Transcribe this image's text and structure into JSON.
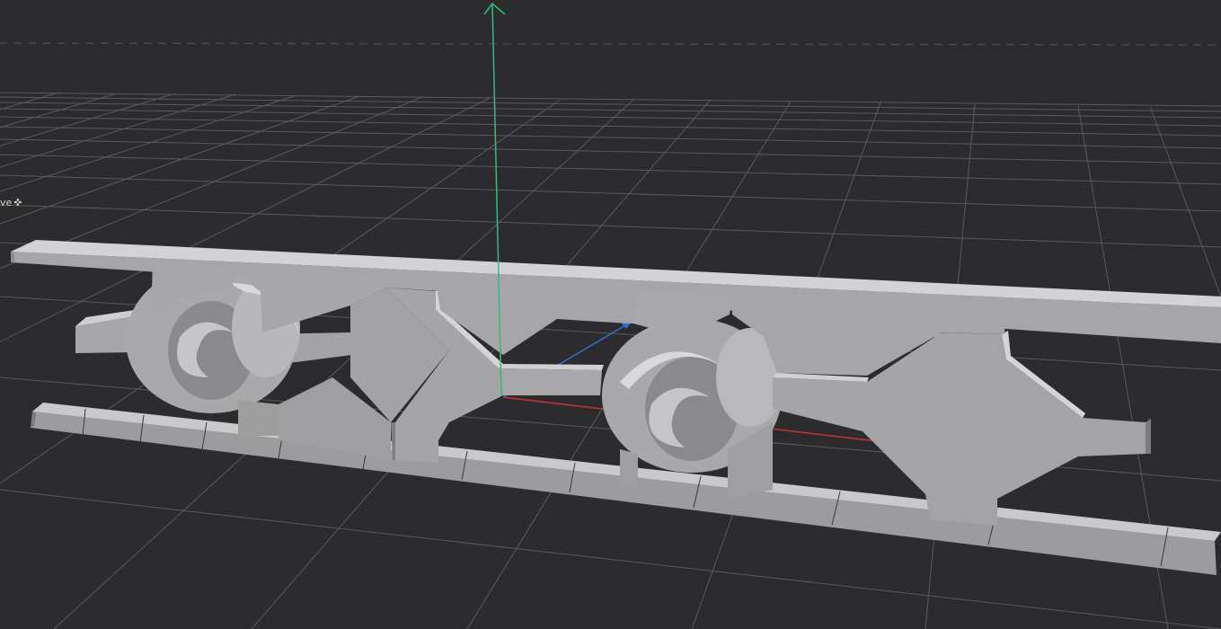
{
  "viewport": {
    "background_color": "#2c2c2e",
    "grid_color": "#5a5a5c",
    "horizon_line_style": "dashed",
    "nav_mode_label": "ve",
    "nav_mode_icon": "move-crosshair-icon",
    "gizmo": {
      "y_axis_color": "#2fbf7a",
      "x_axis_color": "#c0343a",
      "z_axis_color": "#2f6fd0"
    },
    "model": {
      "name_hidden": true,
      "surface_color": "#a3a3a5",
      "highlight_color": "#d2d2d4",
      "shadow_color": "#7b7b7d"
    }
  }
}
